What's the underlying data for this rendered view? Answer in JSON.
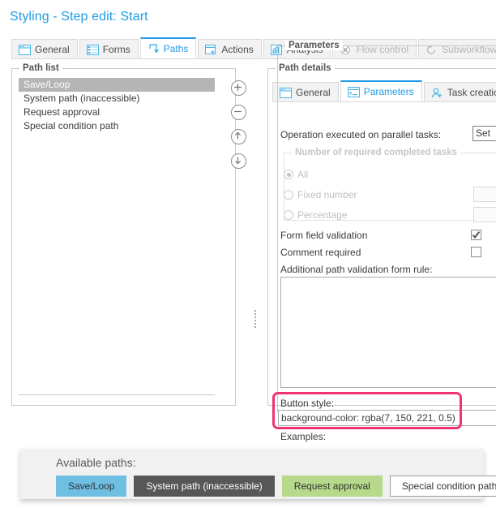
{
  "window": {
    "title": "Styling - Step edit: Start"
  },
  "main_tabs": [
    {
      "label": "General",
      "icon": "window-icon",
      "state": "normal"
    },
    {
      "label": "Forms",
      "icon": "form-list-icon",
      "state": "normal"
    },
    {
      "label": "Paths",
      "icon": "path-arrow-icon",
      "state": "active"
    },
    {
      "label": "Actions",
      "icon": "action-lightning-icon",
      "state": "normal"
    },
    {
      "label": "Analysis",
      "icon": "bar-chart-icon",
      "state": "normal"
    },
    {
      "label": "Flow control",
      "icon": "flow-control-icon",
      "state": "disabled"
    },
    {
      "label": "Subworkflows sett",
      "icon": "subworkflow-icon",
      "state": "disabled"
    }
  ],
  "path_list": {
    "group_title": "Path list",
    "items": [
      {
        "label": "Save/Loop",
        "selected": true
      },
      {
        "label": "System path (inaccessible)",
        "selected": false
      },
      {
        "label": "Request approval",
        "selected": false
      },
      {
        "label": "Special condition path",
        "selected": false
      }
    ],
    "buttons": [
      {
        "name": "add-path-button",
        "glyph": "+"
      },
      {
        "name": "remove-path-button",
        "glyph": "−"
      },
      {
        "name": "move-path-up-button",
        "glyph": "↑"
      },
      {
        "name": "move-path-down-button",
        "glyph": "↓"
      }
    ]
  },
  "path_details": {
    "group_title": "Path details",
    "tabs": [
      {
        "label": "General",
        "icon": "window-icon",
        "state": "normal"
      },
      {
        "label": "Parameters",
        "icon": "console-icon",
        "state": "active"
      },
      {
        "label": "Task creation",
        "icon": "user-add-icon",
        "state": "normal"
      }
    ],
    "parameters": {
      "group_title": "Parameters",
      "operation_label": "Operation executed on parallel tasks:",
      "operation_value": "Set",
      "required_tasks": {
        "group_title": "Number of required completed tasks",
        "options": [
          {
            "label": "All",
            "selected": true
          },
          {
            "label": "Fixed number",
            "selected": false
          },
          {
            "label": "Percentage",
            "selected": false
          }
        ],
        "fixed_number_value": "",
        "percentage_value": ""
      },
      "form_field_validation": {
        "label": "Form field validation",
        "checked": true
      },
      "comment_required": {
        "label": "Comment required",
        "checked": false
      },
      "validation_rule_label": "Additional path validation form rule:",
      "validation_rule_value": "",
      "button_style_label": "Button style:",
      "button_style_value": "background-color: rgba(7, 150, 221, 0.5)",
      "examples_label": "Examples:"
    }
  },
  "available_paths": {
    "title": "Available paths:",
    "buttons": [
      {
        "label": "Save/Loop",
        "bg": "#6fbfe3",
        "fg": "#333333",
        "border": "#6fbfe3"
      },
      {
        "label": "System path (inaccessible)",
        "bg": "#575757",
        "fg": "#ffffff",
        "border": "#575757"
      },
      {
        "label": "Request approval",
        "bg": "#b6d98b",
        "fg": "#333333",
        "border": "#b6d98b"
      },
      {
        "label": "Special condition path",
        "bg": "#ffffff",
        "fg": "#333333",
        "border": "#9a9a9a"
      }
    ]
  },
  "highlight": {
    "name": "button-style-highlight",
    "color": "#f0336e"
  }
}
